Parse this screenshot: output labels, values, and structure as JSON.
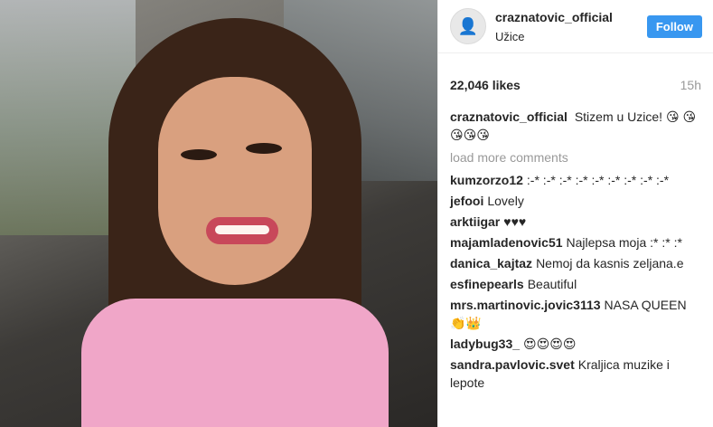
{
  "post": {
    "username": "craznatovic_official",
    "location": "Užice",
    "follow_label": "Follow",
    "likes": "22,046 likes",
    "time": "15h"
  },
  "caption": {
    "username": "craznatovic_official",
    "text": "Stizem u Uzice! 😘 😘😘😘😘"
  },
  "load_more": "load more comments",
  "comments": [
    {
      "user": "kumzorzo12",
      "text": ":-* :-* :-* :-* :-* :-* :-* :-* :-*"
    },
    {
      "user": "jefooi",
      "text": "Lovely"
    },
    {
      "user": "arktiigar",
      "text": "♥♥♥"
    },
    {
      "user": "majamladenovic51",
      "text": "Najlepsa moja :* :* :*"
    },
    {
      "user": "danica_kajtaz",
      "text": "Nemoj da kasnis zeljana.e"
    },
    {
      "user": "esfinepearls",
      "text": "Beautiful"
    },
    {
      "user": "mrs.martinovic.jovic3113",
      "text": "NASA QUEEN👏👑"
    },
    {
      "user": "ladybug33_",
      "text": "😍😍😍😍"
    },
    {
      "user": "sandra.pavlovic.svet",
      "text": "Kraljica muzike i lepote"
    }
  ]
}
